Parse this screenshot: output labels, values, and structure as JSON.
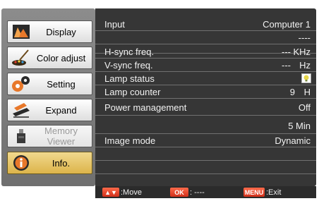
{
  "sidebar": {
    "items": [
      {
        "label": "Display",
        "icon": "display-icon",
        "state": "normal"
      },
      {
        "label": "Color adjust",
        "icon": "color-adjust-icon",
        "state": "normal"
      },
      {
        "label": "Setting",
        "icon": "setting-gears-icon",
        "state": "normal"
      },
      {
        "label": "Expand",
        "icon": "expand-icon",
        "state": "normal"
      },
      {
        "label": "Memory\nViewer",
        "icon": "memory-viewer-icon",
        "state": "disabled"
      },
      {
        "label": "Info.",
        "icon": "info-icon",
        "state": "selected"
      }
    ]
  },
  "info": {
    "input_label": "Input",
    "input_value": "Computer 1",
    "signal_value": "----",
    "hsync_label": "H-sync freq.",
    "hsync_value": "---",
    "hsync_unit": "KHz",
    "vsync_label": "V-sync freq.",
    "vsync_value": "---",
    "vsync_unit": "Hz",
    "lamp_status_label": "Lamp status",
    "lamp_counter_label": "Lamp counter",
    "lamp_counter_value": "9",
    "lamp_counter_unit": "H",
    "power_label": "Power management",
    "power_value": "Off",
    "power_time_value": "5 Min",
    "image_mode_label": "Image mode",
    "image_mode_value": "Dynamic"
  },
  "footer": {
    "move_key": "▲▼",
    "move_label": ":Move",
    "ok_key": "OK",
    "ok_label": ": ----",
    "menu_key": "MENU",
    "menu_label": ":Exit"
  },
  "colors": {
    "panel_bg": "#363636",
    "sidebar_bg": "#7d7d7d",
    "selected_item": "#dcb44a",
    "key_red": "#d0301a"
  }
}
